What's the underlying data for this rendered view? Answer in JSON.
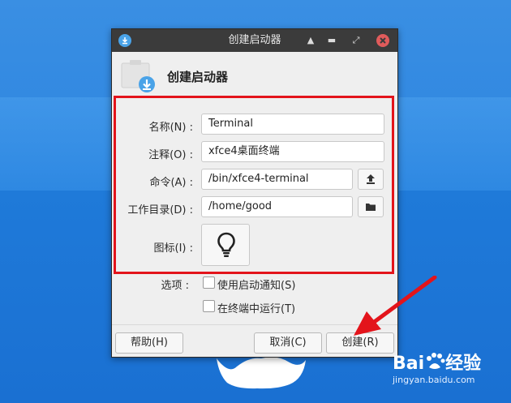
{
  "window": {
    "title": "创建启动器",
    "controls": [
      "shade-icon",
      "minimize-icon",
      "maximize-icon",
      "close-icon"
    ]
  },
  "header": {
    "title": "创建启动器",
    "icon": "launcher-download-icon"
  },
  "form": {
    "name": {
      "label": "名称(N) :",
      "value": "Terminal"
    },
    "comment": {
      "label": "注释(O) :",
      "value": "xfce4桌面终端"
    },
    "command": {
      "label": "命令(A) :",
      "value": "/bin/xfce4-terminal",
      "button_icon": "upload-icon"
    },
    "workdir": {
      "label": "工作目录(D) :",
      "value": "/home/good",
      "button_icon": "folder-icon"
    },
    "icon": {
      "label": "图标(I) :",
      "icon": "lightbulb-icon"
    }
  },
  "options": {
    "label": "选项 :",
    "startup_notify": {
      "label": "使用启动通知(S)",
      "checked": false
    },
    "run_in_terminal": {
      "label": "在终端中运行(T)",
      "checked": false
    }
  },
  "buttons": {
    "help": "帮助(H)",
    "cancel": "取消(C)",
    "create": "创建(R)"
  },
  "watermark": {
    "brand": "Bai",
    "brand2": "经验",
    "url": "jingyan.baidu.com"
  },
  "colors": {
    "highlight": "#e3141b",
    "titlebar": "#3b3b3b",
    "accent": "#4aa3e8"
  }
}
